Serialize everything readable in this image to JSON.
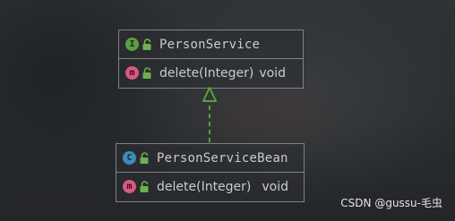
{
  "interface_box": {
    "badge": "I",
    "name": "PersonService",
    "method": "delete(Integer)",
    "method_badge": "m",
    "return_type": "void"
  },
  "class_box": {
    "badge": "C",
    "name": "PersonServiceBean",
    "method": "delete(Integer)",
    "method_badge": "m",
    "return_type": "void"
  },
  "relation": {
    "type": "implements",
    "style": "dashed",
    "color": "#5aa03c"
  },
  "watermark": "CSDN @gussu-毛虫",
  "colors": {
    "interface_badge": "#5e9c42",
    "class_badge": "#3e8db8",
    "method_badge": "#d85a82",
    "border": "#7d8287"
  }
}
